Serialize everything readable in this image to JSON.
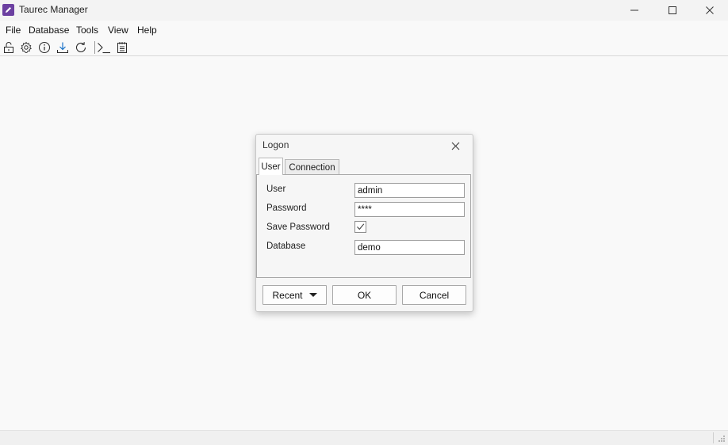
{
  "window": {
    "title": "Taurec Manager",
    "controls": {
      "minimize": "minimize-icon",
      "maximize": "maximize-icon",
      "close": "close-icon"
    }
  },
  "menu": {
    "items": [
      {
        "label": "File"
      },
      {
        "label": "Database"
      },
      {
        "label": "Tools"
      },
      {
        "label": "View"
      },
      {
        "label": "Help"
      }
    ]
  },
  "toolbar": {
    "buttons": [
      {
        "icon": "unlock-icon"
      },
      {
        "icon": "gear-icon"
      },
      {
        "icon": "info-icon"
      },
      {
        "icon": "download-icon"
      },
      {
        "icon": "refresh-icon"
      },
      {
        "icon": "terminal-icon"
      },
      {
        "icon": "notepad-icon"
      }
    ]
  },
  "dialog": {
    "title": "Logon",
    "tabs": [
      {
        "label": "User",
        "selected": true
      },
      {
        "label": "Connection",
        "selected": false
      }
    ],
    "fields": {
      "user_label": "User",
      "user_value": "admin",
      "password_label": "Password",
      "password_value": "****",
      "save_password_label": "Save Password",
      "save_password_checked": true,
      "database_label": "Database",
      "database_value": "demo"
    },
    "buttons": {
      "recent": "Recent",
      "ok": "OK",
      "cancel": "Cancel"
    }
  },
  "colors": {
    "app_icon": "#6b3fa0",
    "background": "#f9f9f9",
    "toolbar_icon": "#2a2a2a",
    "download_accent": "#1a73c8"
  }
}
